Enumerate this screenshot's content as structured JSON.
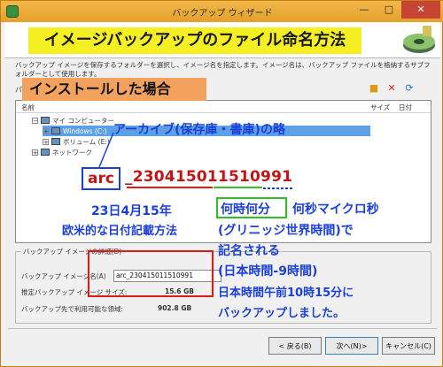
{
  "window": {
    "title": "バックアップ ウィザード",
    "controls": [
      "—",
      "□",
      "✕"
    ]
  },
  "desc": "バックアップ イメージを保存するフォルダーを選択し、イメージ名を指定します。イメージ名は、バックアップ ファイルを格納するサブフォルダーとして使用します。",
  "name_row_label": "パ",
  "tree": {
    "headers": {
      "name": "名前",
      "size": "サイズ",
      "date": "日付"
    },
    "nodes": [
      {
        "label": "マイ コンピューター",
        "expander": "−"
      },
      {
        "label": "Windows (C:)",
        "expander": "+",
        "selected": true
      },
      {
        "label": "ボリューム (E:)",
        "expander": "+"
      },
      {
        "label": "ネットワーク",
        "expander": "+"
      }
    ]
  },
  "details": {
    "title": "バックアップ イメージの詳細(D)",
    "image_name_label": "バックアップ イメージ名(A)",
    "image_name_value": "arc_230415011510991",
    "est_size_label": "推定バックアップ イメージ サイズ:",
    "est_size_value": "15.6 GB",
    "available_label": "バックアップ先で利用可能な領域:",
    "available_value": "902.8 GB"
  },
  "buttons": {
    "back": "< 戻る(B)",
    "next": "次へ(N)>",
    "cancel": "キャンセル(C)"
  },
  "annotations": {
    "banner": "イメージバックアップのファイル命名方法",
    "case": "インストールした場合",
    "archive_note": "アーカイブ(保存庫・書庫)の略",
    "prefix": "arc",
    "sep": "_",
    "digits": "230415011510991",
    "date_note_1": "23日4月15年",
    "date_note_2": "欧米的な日付記載方法",
    "time_box": "何時何分",
    "time_note_1": "何秒マイクロ秒",
    "time_note_2": "(グリニッジ世界時間)で",
    "time_note_3": "記名される",
    "time_note_4": "(日本時間-9時間)",
    "time_note_5": "日本時間午前10時15分に",
    "time_note_6": "バックアップしました。"
  }
}
